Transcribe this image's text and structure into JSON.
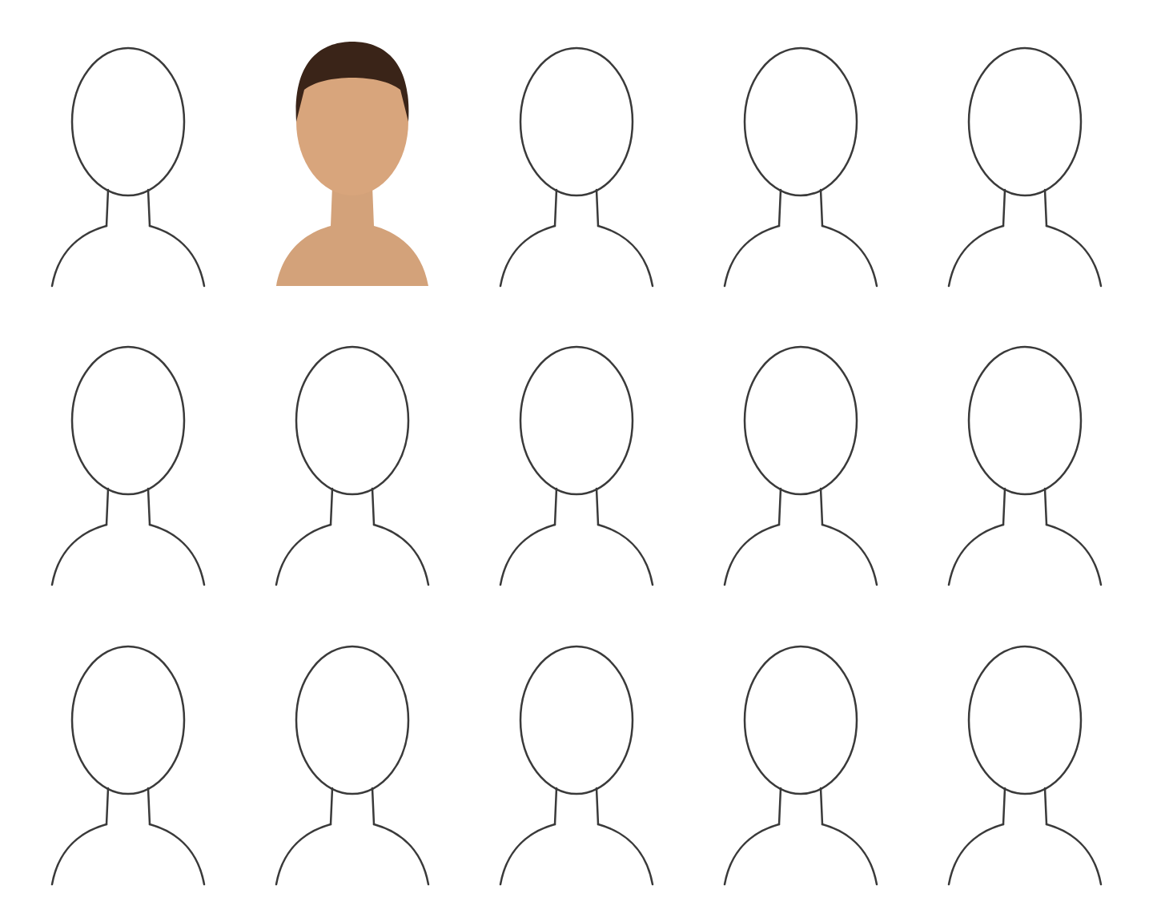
{
  "sketches": [
    {
      "kind": "line"
    },
    {
      "kind": "painted"
    },
    {
      "kind": "line"
    },
    {
      "kind": "line"
    },
    {
      "kind": "line"
    },
    {
      "kind": "line"
    },
    {
      "kind": "line"
    },
    {
      "kind": "line"
    },
    {
      "kind": "line"
    },
    {
      "kind": "line"
    },
    {
      "kind": "line"
    },
    {
      "kind": "line"
    },
    {
      "kind": "line"
    },
    {
      "kind": "line"
    },
    {
      "kind": "line"
    }
  ]
}
